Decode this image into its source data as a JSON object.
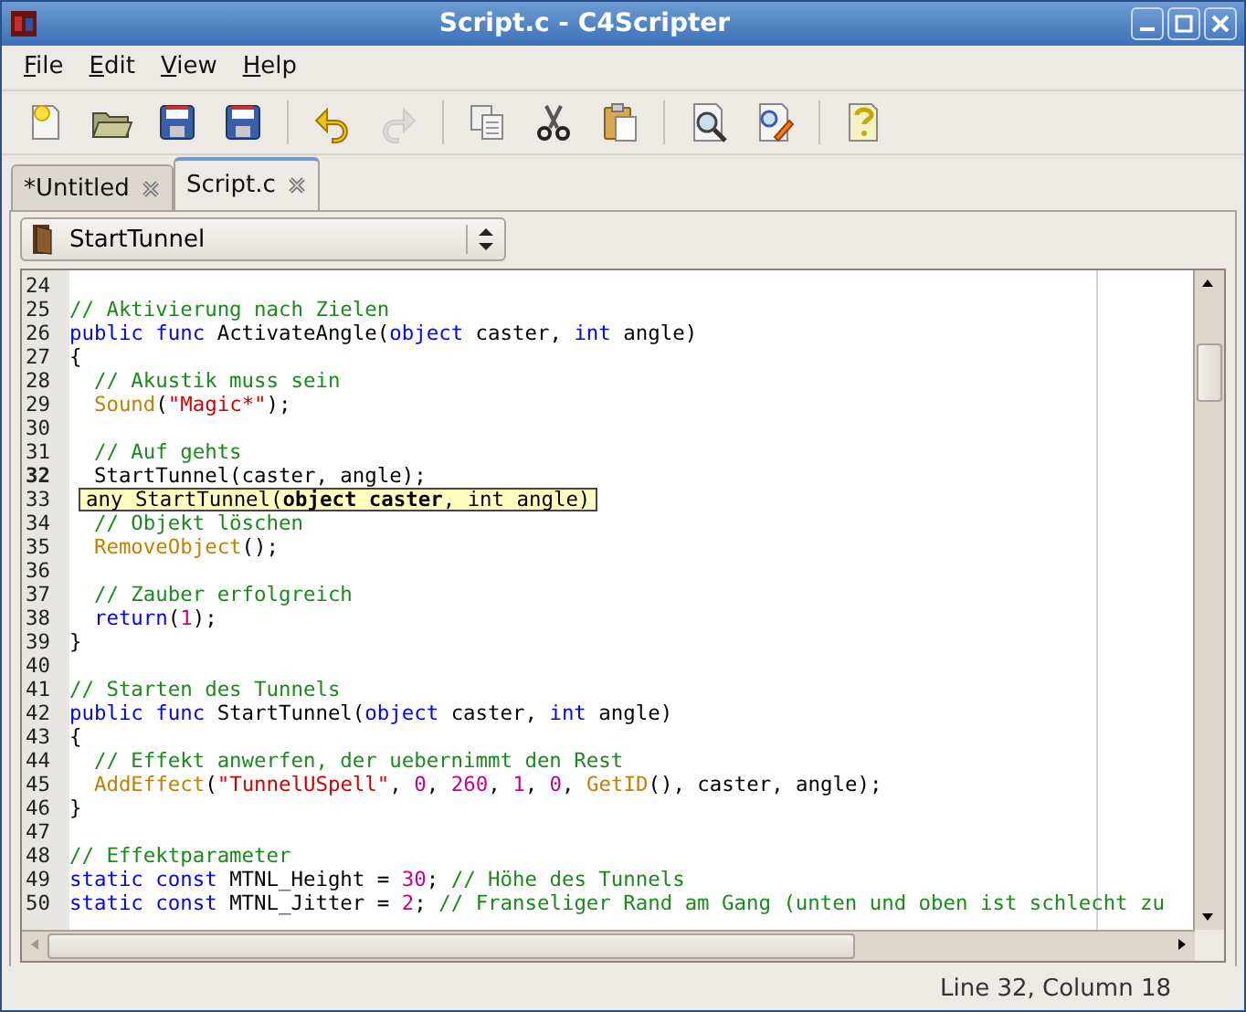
{
  "window": {
    "title": "Script.c - C4Scripter"
  },
  "menu": [
    {
      "label": "File"
    },
    {
      "label": "Edit"
    },
    {
      "label": "View"
    },
    {
      "label": "Help"
    }
  ],
  "toolbar": [
    {
      "kind": "new",
      "disabled": false
    },
    {
      "kind": "open",
      "disabled": false
    },
    {
      "kind": "save",
      "disabled": false
    },
    {
      "kind": "save",
      "disabled": false
    },
    {
      "kind": "sep"
    },
    {
      "kind": "undo",
      "disabled": false
    },
    {
      "kind": "redo",
      "disabled": true
    },
    {
      "kind": "sep"
    },
    {
      "kind": "copy",
      "disabled": false
    },
    {
      "kind": "cut",
      "disabled": false
    },
    {
      "kind": "paste",
      "disabled": false
    },
    {
      "kind": "sep"
    },
    {
      "kind": "find",
      "disabled": false
    },
    {
      "kind": "replace",
      "disabled": false
    },
    {
      "kind": "sep"
    },
    {
      "kind": "help",
      "disabled": false
    }
  ],
  "tabs": [
    {
      "label": "*Untitled",
      "selected": false
    },
    {
      "label": "Script.c",
      "selected": true
    }
  ],
  "function_selector": {
    "value": "StartTunnel"
  },
  "editor": {
    "lines": [
      {
        "number": "24",
        "current": false
      },
      {
        "number": "25",
        "current": false,
        "indented": false,
        "tokens": [
          {
            "kind": "comment",
            "text": "// Aktivierung nach Zielen"
          }
        ]
      },
      {
        "number": "26",
        "current": false,
        "indented": false,
        "tokens": [
          {
            "kind": "keyword",
            "text": "public func"
          },
          {
            "kind": "plain",
            "text": " ActivateAngle("
          },
          {
            "kind": "keyword",
            "text": "object"
          },
          {
            "kind": "plain",
            "text": " caster, "
          },
          {
            "kind": "keyword",
            "text": "int"
          },
          {
            "kind": "plain",
            "text": " angle)"
          }
        ]
      },
      {
        "number": "27",
        "current": false,
        "indented": false,
        "tokens": [
          {
            "kind": "plain",
            "text": "{"
          }
        ]
      },
      {
        "number": "28",
        "current": false,
        "indented": true,
        "tokens": [
          {
            "kind": "comment",
            "text": "// Akustik muss sein"
          }
        ]
      },
      {
        "number": "29",
        "current": false,
        "indented": true,
        "tokens": [
          {
            "kind": "function",
            "text": "Sound"
          },
          {
            "kind": "plain",
            "text": "("
          },
          {
            "kind": "string",
            "text": "\"Magic*\""
          },
          {
            "kind": "plain",
            "text": ");"
          }
        ]
      },
      {
        "number": "30",
        "current": false
      },
      {
        "number": "31",
        "current": false,
        "indented": true,
        "tokens": [
          {
            "kind": "comment",
            "text": "// Auf gehts"
          }
        ]
      },
      {
        "number": "32",
        "current": true,
        "indented": true,
        "tokens": [
          {
            "kind": "plain",
            "text": "StartTunnel(caster, angle);"
          }
        ]
      },
      {
        "number": "33",
        "current": false
      },
      {
        "number": "34",
        "current": false,
        "indented": true,
        "tokens": [
          {
            "kind": "comment",
            "text": "// Objekt löschen"
          }
        ]
      },
      {
        "number": "35",
        "current": false,
        "indented": true,
        "tokens": [
          {
            "kind": "function",
            "text": "RemoveObject"
          },
          {
            "kind": "plain",
            "text": "();"
          }
        ]
      },
      {
        "number": "36",
        "current": false
      },
      {
        "number": "37",
        "current": false,
        "indented": true,
        "tokens": [
          {
            "kind": "comment",
            "text": "// Zauber erfolgreich"
          }
        ]
      },
      {
        "number": "38",
        "current": false,
        "indented": true,
        "tokens": [
          {
            "kind": "keyword",
            "text": "return"
          },
          {
            "kind": "plain",
            "text": "("
          },
          {
            "kind": "number",
            "text": "1"
          },
          {
            "kind": "plain",
            "text": ");"
          }
        ]
      },
      {
        "number": "39",
        "current": false,
        "indented": false,
        "tokens": [
          {
            "kind": "plain",
            "text": "}"
          }
        ]
      },
      {
        "number": "40",
        "current": false
      },
      {
        "number": "41",
        "current": false,
        "indented": false,
        "tokens": [
          {
            "kind": "comment",
            "text": "// Starten des Tunnels"
          }
        ]
      },
      {
        "number": "42",
        "current": false,
        "indented": false,
        "tokens": [
          {
            "kind": "keyword",
            "text": "public func"
          },
          {
            "kind": "plain",
            "text": " StartTunnel("
          },
          {
            "kind": "keyword",
            "text": "object"
          },
          {
            "kind": "plain",
            "text": " caster, "
          },
          {
            "kind": "keyword",
            "text": "int"
          },
          {
            "kind": "plain",
            "text": " angle)"
          }
        ]
      },
      {
        "number": "43",
        "current": false,
        "indented": false,
        "tokens": [
          {
            "kind": "plain",
            "text": "{"
          }
        ]
      },
      {
        "number": "44",
        "current": false,
        "indented": true,
        "tokens": [
          {
            "kind": "comment",
            "text": "// Effekt anwerfen, der uebernimmt den Rest"
          }
        ]
      },
      {
        "number": "45",
        "current": false,
        "indented": true,
        "tokens": [
          {
            "kind": "function",
            "text": "AddEffect"
          },
          {
            "kind": "plain",
            "text": "("
          },
          {
            "kind": "string",
            "text": "\"TunnelUSpell\""
          },
          {
            "kind": "plain",
            "text": ", "
          },
          {
            "kind": "number",
            "text": "0"
          },
          {
            "kind": "plain",
            "text": ", "
          },
          {
            "kind": "number",
            "text": "260"
          },
          {
            "kind": "plain",
            "text": ", "
          },
          {
            "kind": "number",
            "text": "1"
          },
          {
            "kind": "plain",
            "text": ", "
          },
          {
            "kind": "number",
            "text": "0"
          },
          {
            "kind": "plain",
            "text": ", "
          },
          {
            "kind": "function",
            "text": "GetID"
          },
          {
            "kind": "plain",
            "text": "(), caster, angle);"
          }
        ]
      },
      {
        "number": "46",
        "current": false,
        "indented": false,
        "tokens": [
          {
            "kind": "plain",
            "text": "}"
          }
        ]
      },
      {
        "number": "47",
        "current": false
      },
      {
        "number": "48",
        "current": false,
        "indented": false,
        "tokens": [
          {
            "kind": "comment",
            "text": "// Effektparameter"
          }
        ]
      },
      {
        "number": "49",
        "current": false,
        "indented": false,
        "tokens": [
          {
            "kind": "keyword",
            "text": "static const"
          },
          {
            "kind": "plain",
            "text": " MTNL_Height = "
          },
          {
            "kind": "number",
            "text": "30"
          },
          {
            "kind": "plain",
            "text": "; "
          },
          {
            "kind": "comment",
            "text": "// Höhe des Tunnels"
          }
        ]
      },
      {
        "number": "50",
        "current": false,
        "indented": false,
        "tokens": [
          {
            "kind": "keyword",
            "text": "static const"
          },
          {
            "kind": "plain",
            "text": " MTNL_Jitter = "
          },
          {
            "kind": "number",
            "text": "2"
          },
          {
            "kind": "plain",
            "text": "; "
          },
          {
            "kind": "comment",
            "text": "// Franseliger Rand am Gang (unten und oben ist schlecht zu"
          }
        ]
      }
    ]
  },
  "calltip": {
    "text": "any StartTunnel(**object caster**, int angle)"
  },
  "status_bar": {
    "position": "Line 32, Column 18"
  }
}
